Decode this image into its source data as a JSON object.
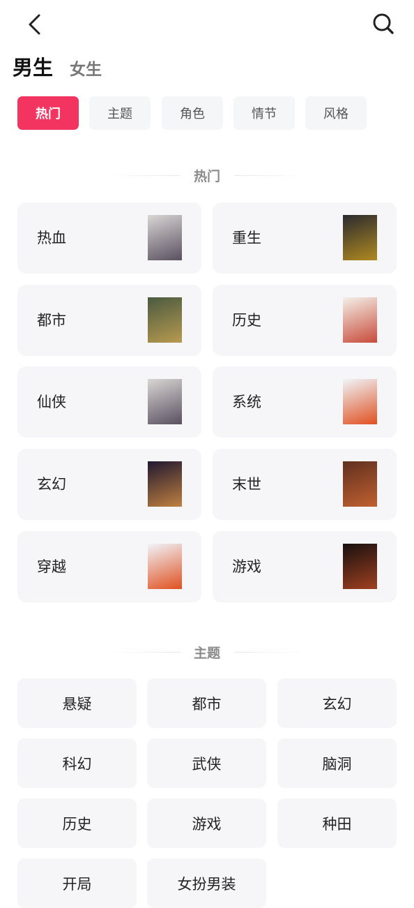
{
  "header": {
    "back_icon": "chevron-left-icon",
    "search_icon": "search-icon"
  },
  "gender_tabs": [
    {
      "label": "男生",
      "selected": true
    },
    {
      "label": "女生",
      "selected": false
    }
  ],
  "category_tabs": [
    {
      "label": "热门",
      "active": true
    },
    {
      "label": "主题"
    },
    {
      "label": "角色"
    },
    {
      "label": "情节"
    },
    {
      "label": "风格"
    }
  ],
  "colors": {
    "accent": "#f33461",
    "card_bg": "#f6f6f8"
  },
  "hot_section": {
    "title": "热门",
    "items": [
      {
        "label": "热血",
        "cover": [
          "#d9d6d4",
          "#5a5060"
        ]
      },
      {
        "label": "重生",
        "cover": [
          "#2a2a30",
          "#b08a20"
        ]
      },
      {
        "label": "都市",
        "cover": [
          "#4a5a40",
          "#b89a50"
        ]
      },
      {
        "label": "历史",
        "cover": [
          "#f4f0e8",
          "#c84a3a"
        ]
      },
      {
        "label": "仙侠",
        "cover": [
          "#d9d6d4",
          "#5a5060"
        ]
      },
      {
        "label": "系统",
        "cover": [
          "#f0f4fa",
          "#e05020"
        ]
      },
      {
        "label": "玄幻",
        "cover": [
          "#201830",
          "#c08040"
        ]
      },
      {
        "label": "末世",
        "cover": [
          "#603020",
          "#c06030"
        ]
      },
      {
        "label": "穿越",
        "cover": [
          "#f0f4fa",
          "#e05020"
        ]
      },
      {
        "label": "游戏",
        "cover": [
          "#181010",
          "#a04020"
        ]
      }
    ]
  },
  "topic_section": {
    "title": "主题",
    "items": [
      "悬疑",
      "都市",
      "玄幻",
      "科幻",
      "武侠",
      "脑洞",
      "历史",
      "游戏",
      "种田",
      "开局",
      "女扮男装"
    ]
  }
}
